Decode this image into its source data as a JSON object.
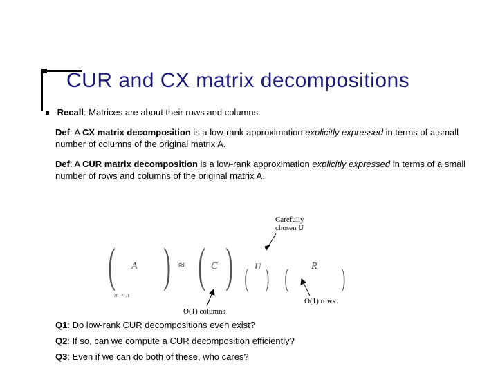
{
  "title": "CUR and CX matrix decompositions",
  "recall": {
    "label": "Recall",
    "text": ": Matrices are about their rows and columns."
  },
  "def_cx": {
    "label": "Def",
    "pre": ": A ",
    "term": "CX matrix decomposition",
    "mid": " is a low-rank approximation ",
    "em": "explicitly expressed",
    "post": " in terms of a small number of columns of the original matrix A."
  },
  "def_cur": {
    "label": "Def",
    "pre": ": A ",
    "term": "CUR matrix decomposition",
    "mid": " is a low-rank approximation ",
    "em": "explicitly expressed",
    "post": " in terms of a small number of rows and columns of the original matrix A."
  },
  "diagram": {
    "A": "A",
    "Asub": "m × n",
    "approx": "≈",
    "C": "C",
    "U": "U",
    "R": "R",
    "anno_u": "Carefully chosen U",
    "anno_cols": "O(1) columns",
    "anno_rows": "O(1) rows"
  },
  "q1": {
    "label": "Q1",
    "text": ": Do low-rank CUR decompositions even exist?"
  },
  "q2": {
    "label": "Q2",
    "text": ": If so, can we compute a CUR decomposition efficiently?"
  },
  "q3": {
    "label": "Q3",
    "text": ": Even if we can do both of these, who cares?"
  }
}
